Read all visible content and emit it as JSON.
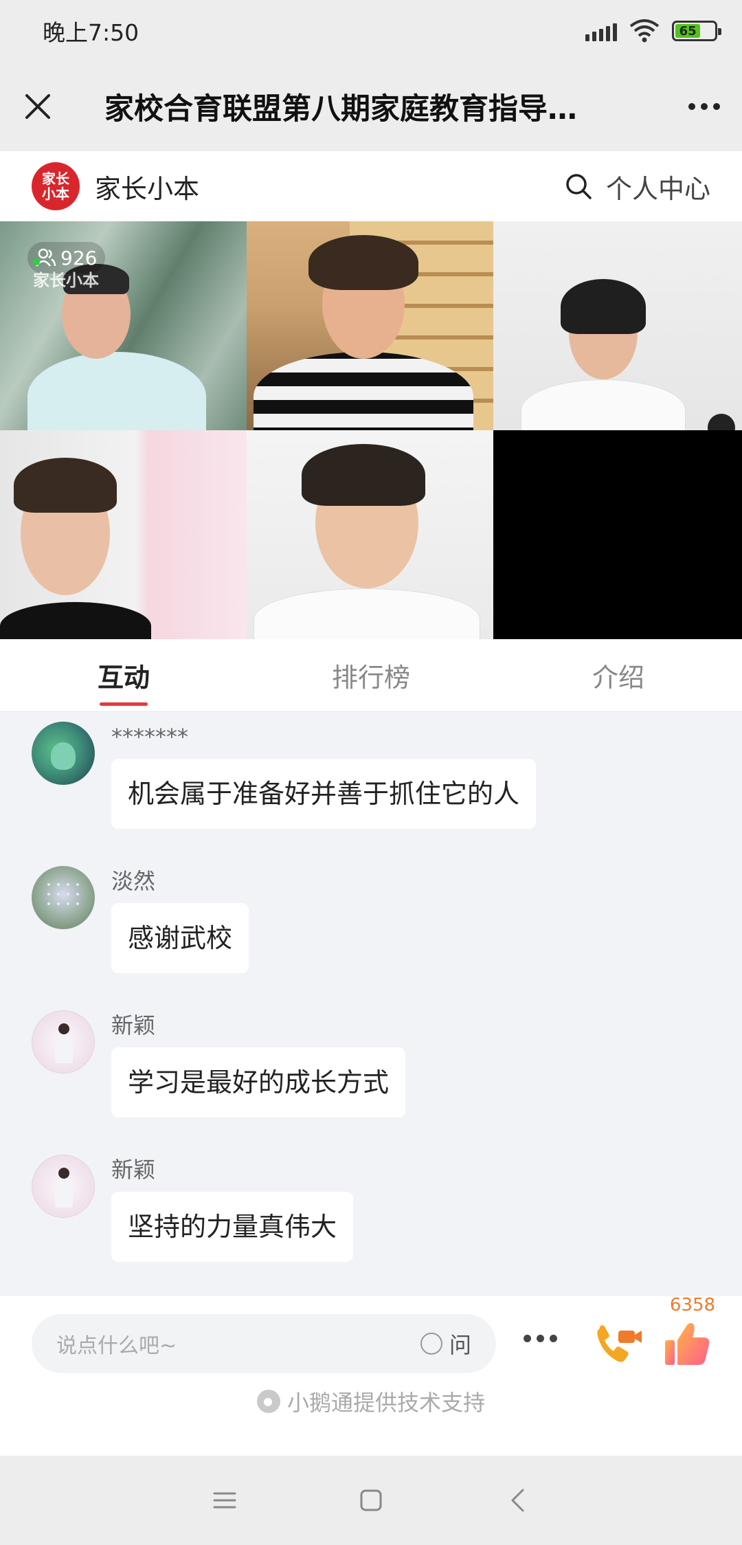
{
  "status_bar": {
    "time": "晚上7:50",
    "battery": "65",
    "battery_level": 0.65
  },
  "nav": {
    "title": "家校合育联盟第八期家庭教育指导…"
  },
  "header": {
    "logo_text": "家长小本",
    "brand_name": "家长小本",
    "personal_center": "个人中心"
  },
  "video": {
    "viewer_count": "926",
    "watermark": "家长小本"
  },
  "tabs": [
    {
      "label": "互动",
      "active": true
    },
    {
      "label": "排行榜",
      "active": false
    },
    {
      "label": "介绍",
      "active": false
    }
  ],
  "messages": [
    {
      "name": "*******",
      "text": "机会属于准备好并善于抓住它的人",
      "avatar": "dragon-avatar"
    },
    {
      "name": "淡然",
      "text": "感谢武校",
      "avatar": "flowers-avatar"
    },
    {
      "name": "新颖",
      "text": "学习是最好的成长方式",
      "avatar": "girl-avatar"
    },
    {
      "name": "新颖",
      "text": "坚持的力量真伟大",
      "avatar": "girl-avatar"
    }
  ],
  "input": {
    "placeholder": "说点什么吧~",
    "ask_label": "问"
  },
  "like_count": "6358",
  "powered_by": "小鹅通提供技术支持",
  "colors": {
    "accent_red": "#e23c3c",
    "like_orange": "#f07b2c",
    "brand_red": "#d9262c"
  }
}
